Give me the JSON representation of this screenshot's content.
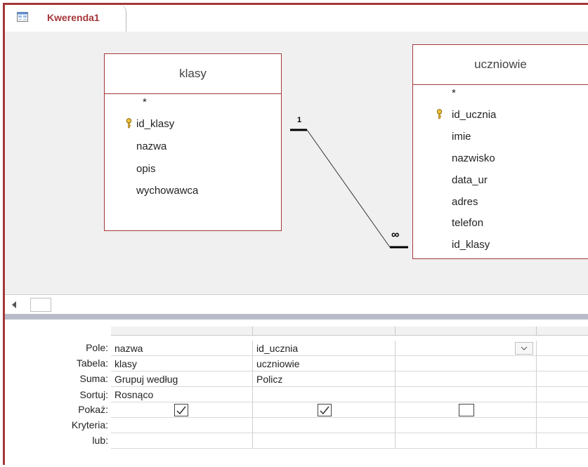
{
  "tab": {
    "title": "Kwerenda1"
  },
  "tables": {
    "klasy": {
      "name": "klasy",
      "fields": [
        "*",
        "id_klasy",
        "nazwa",
        "opis",
        "wychowawca"
      ]
    },
    "uczniowie": {
      "name": "uczniowie",
      "fields": [
        "*",
        "id_ucznia",
        "imie",
        "nazwisko",
        "data_ur",
        "adres",
        "telefon",
        "id_klasy"
      ]
    }
  },
  "relationship": {
    "one_label": "1",
    "many_label": "∞"
  },
  "grid": {
    "row_labels": [
      "Pole:",
      "Tabela:",
      "Suma:",
      "Sortuj:",
      "Pokaż:",
      "Kryteria:",
      "lub:"
    ],
    "columns": [
      {
        "pole": "nazwa",
        "tabela": "klasy",
        "suma": "Grupuj według",
        "sortuj": "Rosnąco",
        "pokaz": true
      },
      {
        "pole": "id_ucznia",
        "tabela": "uczniowie",
        "suma": "Policz",
        "sortuj": "",
        "pokaz": true
      },
      {
        "pole": "",
        "tabela": "",
        "suma": "",
        "sortuj": "",
        "pokaz": false
      }
    ]
  },
  "colors": {
    "accent": "#a4373a",
    "background": "#f0f0f0",
    "splitter": "#b9bcc8"
  }
}
